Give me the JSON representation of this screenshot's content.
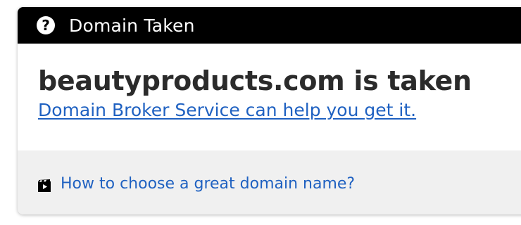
{
  "header": {
    "icon": "question-circle-icon",
    "title": "Domain Taken"
  },
  "main": {
    "status_title": "beautyproducts.com is taken",
    "broker_link": "Domain Broker Service can help you get it."
  },
  "footer": {
    "icon": "video-icon",
    "tips_link": "How to choose a great domain name?"
  },
  "colors": {
    "header_bg": "#000000",
    "link": "#1f61c1",
    "footer_bg": "#f0f0f0",
    "title_text": "#2b2b2b"
  }
}
